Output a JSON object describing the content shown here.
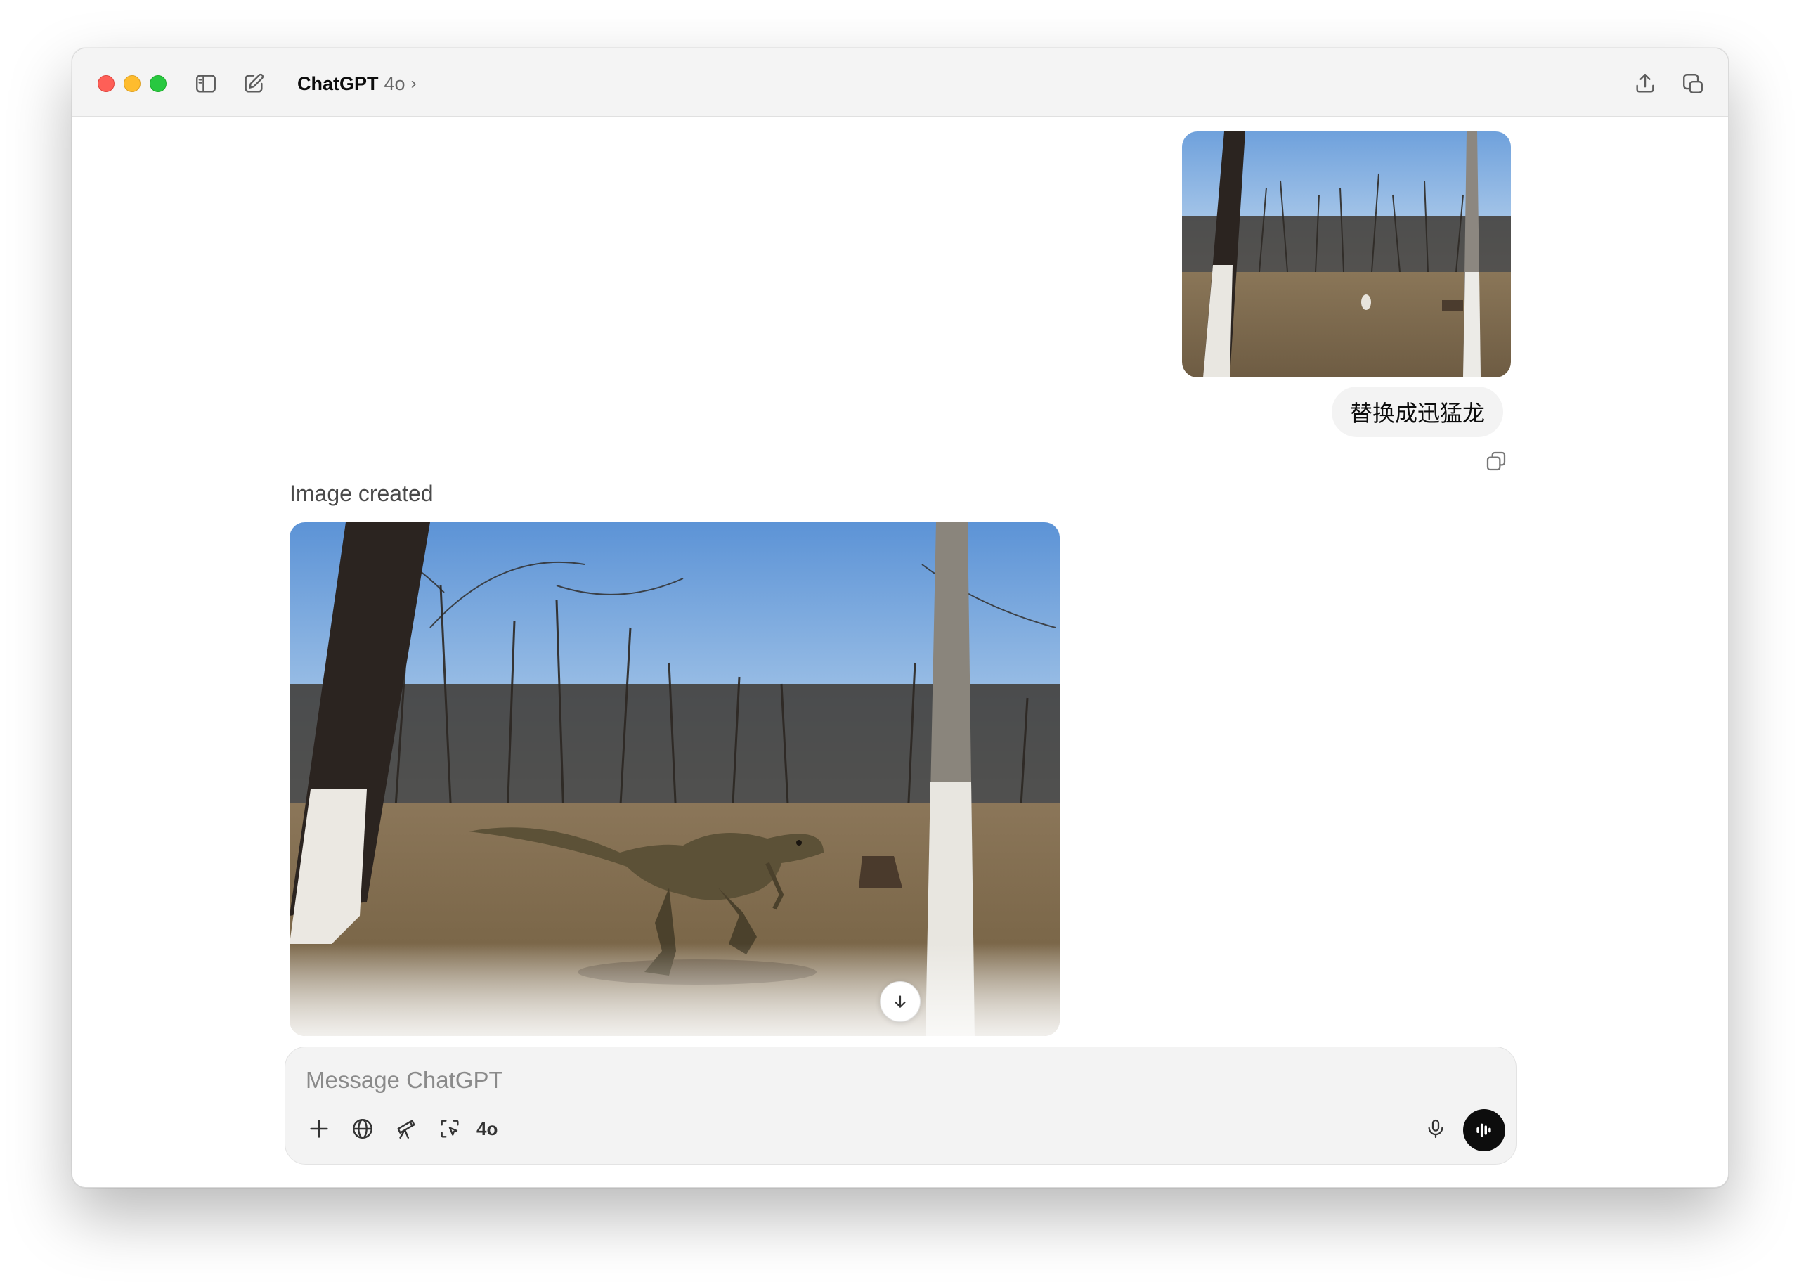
{
  "window": {
    "model_name": "ChatGPT",
    "model_version": "4o",
    "chevron": "›"
  },
  "icons": {
    "sidebar": "sidebar-toggle-icon",
    "new_chat": "compose-icon",
    "share": "share-icon",
    "new_window": "new-window-icon",
    "copy": "copy-icon",
    "download": "arrow-down-icon",
    "plus": "plus-icon",
    "web": "globe-icon",
    "research": "telescope-icon",
    "select": "screen-select-icon",
    "mic": "microphone-icon",
    "voice": "voice-waveform-icon"
  },
  "conversation": {
    "user_message": "替换成迅猛龙",
    "assistant_status": "Image created"
  },
  "composer": {
    "placeholder": "Message ChatGPT",
    "model_label": "4o"
  },
  "colors": {
    "traffic_red": "#fe5f57",
    "traffic_yellow": "#febc2e",
    "traffic_green": "#28c840",
    "voice_button": "#0d0d0d",
    "bubble_bg": "#f3f3f3"
  }
}
